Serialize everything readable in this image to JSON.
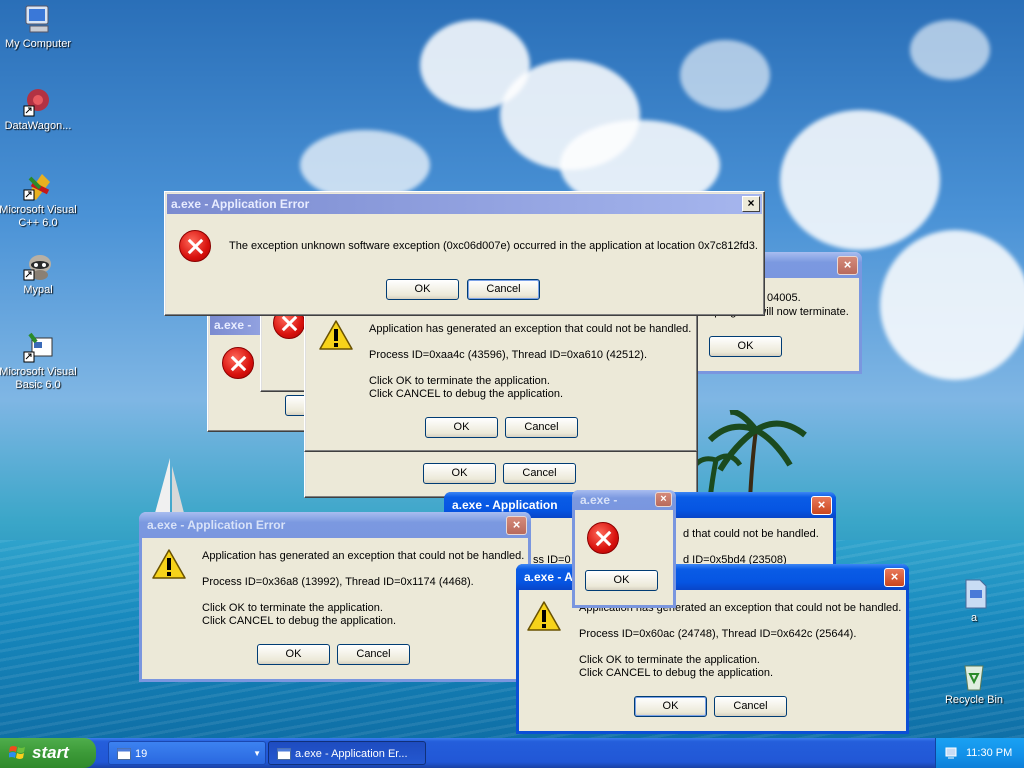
{
  "desktop_icons": [
    {
      "label": "My Computer"
    },
    {
      "label": "DataWagon..."
    },
    {
      "label": "Microsoft Visual C++ 6.0"
    },
    {
      "label": "Mypal"
    },
    {
      "label": "Microsoft Visual Basic 6.0"
    },
    {
      "label": "a"
    },
    {
      "label": "Recycle Bin"
    }
  ],
  "dialogs": {
    "top": {
      "title": "a.exe - Application Error",
      "message": "The exception unknown software exception (0xc06d007e) occurred in the application at location 0x7c812fd3.",
      "ok": "OK",
      "cancel": "Cancel",
      "close": "×"
    },
    "right_partial": {
      "fragment1": "04005.",
      "fragment2": "he program will now terminate.",
      "ok": "OK",
      "close": "×"
    },
    "left_stub": {
      "title": "a.exe -"
    },
    "middle": {
      "line1": "Application has generated an exception that could not be handled.",
      "line2": "Process ID=0xaa4c (43596), Thread ID=0xa610 (42512).",
      "line3": "Click OK to terminate the application.",
      "line4": "Click CANCEL to debug the application.",
      "ok": "OK",
      "cancel": "Cancel"
    },
    "middle_behind": {
      "ok": "OK",
      "cancel": "Cancel"
    },
    "center_back": {
      "title": "a.exe - Application",
      "line1": "d that could not be handled.",
      "line2_left": "ss ID=0",
      "line2_right": "d ID=0x5bd4 (23508)",
      "close": "×"
    },
    "small": {
      "title": "a.exe -",
      "ok": "OK",
      "close": "×"
    },
    "bottom_left": {
      "title": "a.exe - Application Error",
      "line1": "Application has generated an exception that could not be handled.",
      "line2": "Process ID=0x36a8 (13992), Thread ID=0x1174 (4468).",
      "line3": "Click OK to terminate the application.",
      "line4": "Click CANCEL to debug the application.",
      "ok": "OK",
      "cancel": "Cancel",
      "close": "×"
    },
    "bottom_right": {
      "title": "a.exe - A",
      "line1": "Application has generated an exception that could not be handled.",
      "line2": "Process ID=0x60ac (24748), Thread ID=0x642c (25644).",
      "line3": "Click OK to terminate the application.",
      "line4": "Click CANCEL to debug the application.",
      "ok": "OK",
      "cancel": "Cancel",
      "close": "×"
    }
  },
  "taskbar": {
    "start_label": "start",
    "tasks": [
      {
        "label": "19"
      },
      {
        "label": "a.exe - Application Er..."
      }
    ],
    "clock": "11:30 PM"
  },
  "colors": {
    "xp_title_active": "#0a5ce6",
    "xp_title_inactive": "#7a96df",
    "dialog_face": "#ece9d8",
    "taskbar": "#245edb",
    "start_button": "#3c9a38"
  }
}
